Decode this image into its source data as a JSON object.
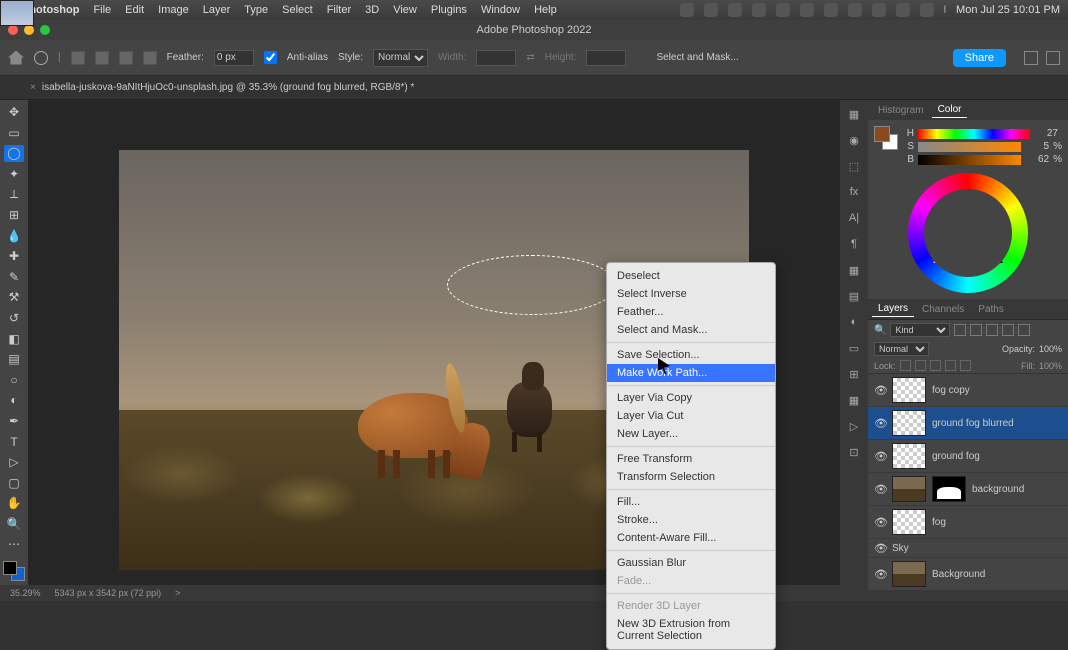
{
  "mac_menu": {
    "app": "Photoshop",
    "items": [
      "File",
      "Edit",
      "Image",
      "Layer",
      "Type",
      "Select",
      "Filter",
      "3D",
      "View",
      "Plugins",
      "Window",
      "Help"
    ],
    "clock": "Mon Jul 25  10:01 PM"
  },
  "title_bar": {
    "title": "Adobe Photoshop 2022"
  },
  "options_bar": {
    "feather_label": "Feather:",
    "feather_value": "0 px",
    "anti_alias": "Anti-alias",
    "style_label": "Style:",
    "style_value": "Normal",
    "width_label": "Width:",
    "height_label": "Height:",
    "select_mask": "Select and Mask...",
    "share": "Share"
  },
  "doc_tab": {
    "close": "×",
    "name": "isabella-juskova-9aNItHjuOc0-unsplash.jpg @ 35.3% (ground fog blurred, RGB/8*) *"
  },
  "color_panel": {
    "tabs": [
      "Histogram",
      "Color"
    ],
    "h_label": "H",
    "h_val": "27",
    "h_pct": "",
    "s_label": "S",
    "s_val": "5",
    "s_pct": "%",
    "b_label": "B",
    "b_val": "62",
    "b_pct": "%"
  },
  "layers_panel": {
    "tabs": [
      "Layers",
      "Channels",
      "Paths"
    ],
    "kind": "Kind",
    "blend": "Normal",
    "opacity_label": "Opacity:",
    "opacity_val": "100%",
    "lock_label": "Lock:",
    "fill_label": "Fill:",
    "fill_val": "100%",
    "layers": [
      {
        "name": "fog copy",
        "thumb": "checker"
      },
      {
        "name": "ground fog blurred",
        "thumb": "checker",
        "sel": true
      },
      {
        "name": "ground fog",
        "thumb": "checker"
      },
      {
        "name": "background",
        "thumb": "img",
        "mask": true
      },
      {
        "name": "fog",
        "thumb": "checker"
      },
      {
        "name": "Sky",
        "thumb": "sky"
      },
      {
        "name": "Background",
        "thumb": "img"
      }
    ]
  },
  "context_menu": {
    "items": [
      {
        "t": "Deselect"
      },
      {
        "t": "Select Inverse"
      },
      {
        "t": "Feather..."
      },
      {
        "t": "Select and Mask..."
      },
      {
        "sep": true
      },
      {
        "t": "Save Selection..."
      },
      {
        "t": "Make Work Path...",
        "hl": true
      },
      {
        "sep": true
      },
      {
        "t": "Layer Via Copy"
      },
      {
        "t": "Layer Via Cut"
      },
      {
        "t": "New Layer..."
      },
      {
        "sep": true
      },
      {
        "t": "Free Transform"
      },
      {
        "t": "Transform Selection"
      },
      {
        "sep": true
      },
      {
        "t": "Fill..."
      },
      {
        "t": "Stroke..."
      },
      {
        "t": "Content-Aware Fill..."
      },
      {
        "sep": true
      },
      {
        "t": "Gaussian Blur"
      },
      {
        "t": "Fade...",
        "dim": true
      },
      {
        "sep": true
      },
      {
        "t": "Render 3D Layer",
        "dim": true
      },
      {
        "t": "New 3D Extrusion from Current Selection"
      }
    ]
  },
  "status": {
    "zoom": "35.29%",
    "dims": "5343 px x 3542 px (72 ppi)",
    "arrow": ">"
  },
  "tools": [
    "move",
    "rect-marquee",
    "lasso",
    "magic-wand",
    "crop",
    "frame",
    "eyedropper",
    "healing",
    "brush",
    "stamp",
    "history-brush",
    "eraser",
    "gradient",
    "blur",
    "dodge",
    "pen",
    "type",
    "path-select",
    "rectangle",
    "hand",
    "zoom",
    "more"
  ]
}
